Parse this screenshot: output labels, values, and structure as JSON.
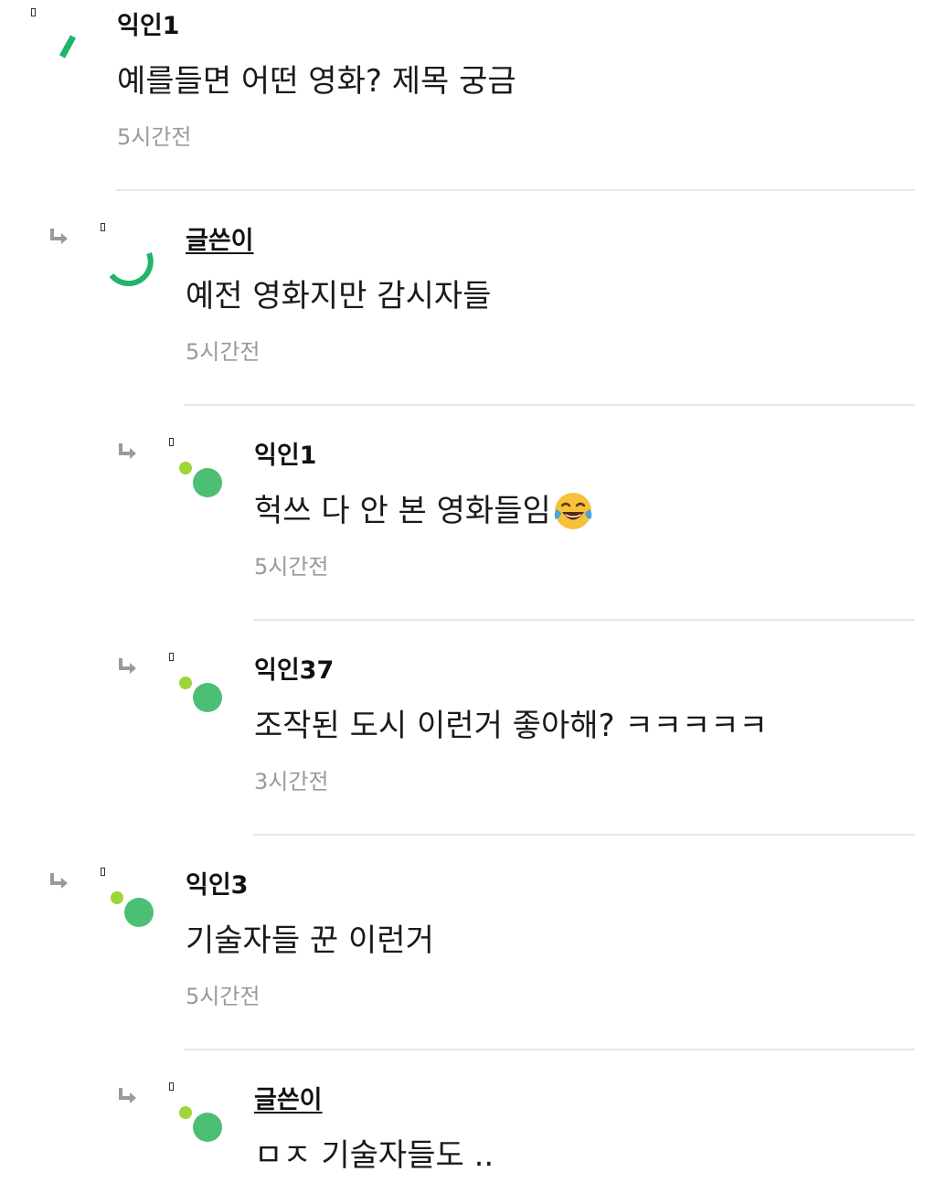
{
  "colors": {
    "divider": "#e6e6e6",
    "time_text": "#9a9a9a",
    "avatar_green": "#4cbf75",
    "avatar_lime": "#9fd43a",
    "avatar_spin_green": "#1fb56f",
    "reply_arrow": "#9a9a9a"
  },
  "icons": {
    "reply_arrow": "reply-arrow-icon",
    "avatar": "avatar-icon",
    "emoji": "face-with-tears-of-joy-emoji"
  },
  "comments": [
    {
      "author": "익인1",
      "text": "예를들면 어떤 영화? 제목 궁금",
      "time": "5시간전",
      "avatar_style": "spinner-top",
      "is_reply": false
    },
    {
      "author": "글쓴이",
      "text": "예전 영화지만 감시자들",
      "time": "5시간전",
      "avatar_style": "spinner-bottom",
      "is_reply": true
    },
    {
      "author": "익인1",
      "text": "헉쓰 다 안 본 영화들임",
      "time": "5시간전",
      "avatar_style": "dots",
      "is_reply": true,
      "emoji": "😂"
    },
    {
      "author": "익인37",
      "text": "조작된 도시 이런거 좋아해? ㅋㅋㅋㅋㅋ",
      "time": "3시간전",
      "avatar_style": "dots",
      "is_reply": true
    },
    {
      "author": "익인3",
      "text": "기술자들 꾼 이런거",
      "time": "5시간전",
      "avatar_style": "dots",
      "is_reply": true
    },
    {
      "author": "글쓴이",
      "text": "ㅁㅈ 기술자들도 ..",
      "time": "",
      "avatar_style": "dots",
      "is_reply": true
    }
  ]
}
